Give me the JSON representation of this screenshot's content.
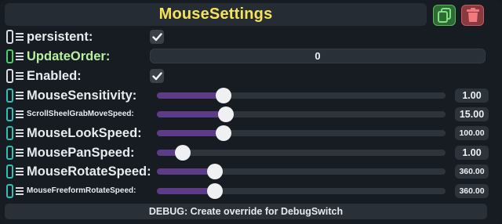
{
  "header": {
    "title": "MouseSettings"
  },
  "header_buttons": {
    "duplicate_icon": "duplicate-icon",
    "delete_icon": "trash-icon"
  },
  "rows": [
    {
      "label": "persistent:",
      "type": "checkbox",
      "checked": true,
      "connector_color": "#d8dce0"
    },
    {
      "label": "UpdateOrder:",
      "type": "number",
      "value": "0",
      "connector_color": "#3fd36a",
      "label_color": "#b8f0a0"
    },
    {
      "label": "Enabled:",
      "type": "checkbox",
      "checked": true,
      "connector_color": "#d8dce0"
    },
    {
      "label": "MouseSensitivity:",
      "type": "slider",
      "value": "1.00",
      "fill": 0.23,
      "connector_color": "#2fbfb5"
    },
    {
      "label": "ScrollSheelGrabMoveSpeed:",
      "type": "slider",
      "value": "15.00",
      "fill": 0.24,
      "connector_color": "#2fbfb5"
    },
    {
      "label": "MouseLookSpeed:",
      "type": "slider",
      "value": "100.00",
      "fill": 0.23,
      "connector_color": "#2fbfb5"
    },
    {
      "label": "MousePanSpeed:",
      "type": "slider",
      "value": "1.00",
      "fill": 0.09,
      "connector_color": "#2fbfb5"
    },
    {
      "label": "MouseRotateSpeed:",
      "type": "slider",
      "value": "360.00",
      "fill": 0.2,
      "connector_color": "#2fbfb5"
    },
    {
      "label": "MouseFreeformRotateSpeed:",
      "type": "slider",
      "value": "360.00",
      "fill": 0.2,
      "connector_color": "#2fbfb5"
    }
  ],
  "footer": {
    "label": "DEBUG: Create override for DebugSwitch"
  },
  "colors": {
    "accent_title": "#f5e45a",
    "slider_fill": "#5c3c86",
    "duplicate_button": "#2f6a34",
    "delete_button": "#8a3a3e"
  }
}
